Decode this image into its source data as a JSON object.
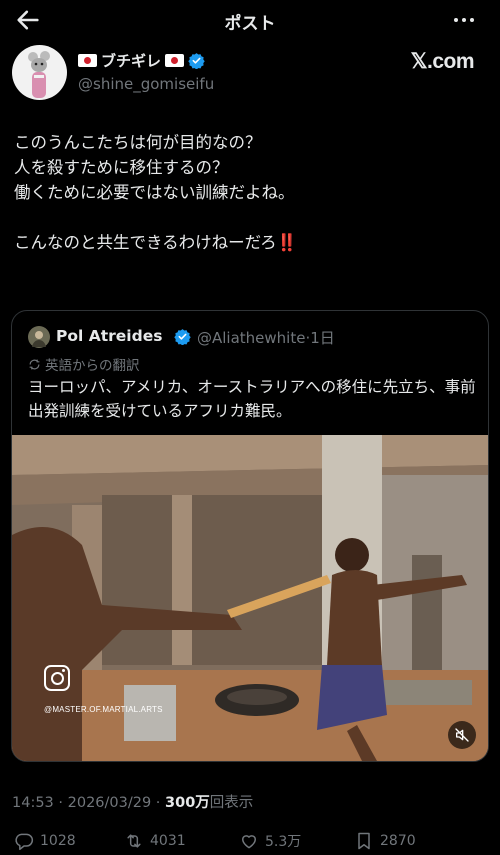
{
  "header": {
    "title": "ポスト"
  },
  "post": {
    "author_name": "ブチギレ",
    "author_handle": "@shine_gomiseifu",
    "brand": "𝕏.com",
    "lines": [
      "このうんこたちは何が目的なの？",
      "人を殺すために移住するの？",
      "働くために必要ではない訓練だよね。",
      "こんなのと共生できるわけねーだろ"
    ],
    "emphasis": "‼️"
  },
  "quote": {
    "author_name": "Pol Atreides",
    "author_handle": "@Aliathewhite",
    "time": "·1日",
    "translation_label": "英語からの翻訳",
    "text": "ヨーロッパ、アメリカ、オーストラリアへの移住に先立ち、事前出発訓練を受けているアフリカ難民。",
    "media_watermark": "@MASTER.OF.MARTIAL.ARTS"
  },
  "meta": {
    "timestamp": "14:53 · 2026/03/29 · ",
    "views": "300万",
    "views_suffix": "回表示"
  },
  "actions": {
    "replies": "1028",
    "reposts": "4031",
    "likes": "5.3万",
    "bookmarks": "2870"
  },
  "colors": {
    "background": "#000000",
    "text": "#e7e9ea",
    "secondary": "#71767b",
    "verified": "#1d9bf0",
    "border": "#2f3336"
  },
  "icons": [
    "back-arrow-icon",
    "more-icon",
    "verified-icon",
    "translate-icon",
    "instagram-icon",
    "mute-icon",
    "reply-icon",
    "repost-icon",
    "like-icon",
    "bookmark-icon"
  ]
}
